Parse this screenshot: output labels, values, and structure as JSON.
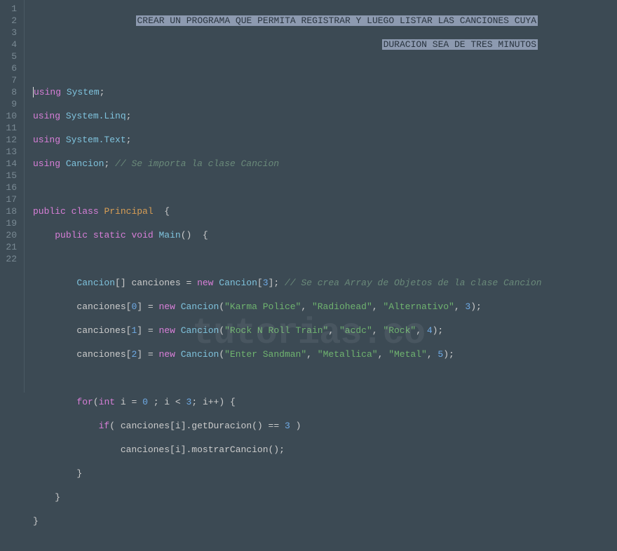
{
  "banner": {
    "line1": "CREAR UN PROGRAMA QUE PERMITA REGISTRAR Y LUEGO LISTAR LAS CANCIONES CUYA",
    "line2": "DURACION SEA DE TRES MINUTOS"
  },
  "code": {
    "kw_using": "using",
    "ns_system": "System",
    "ns_linq": "System.Linq",
    "ns_text": "System.Text",
    "ns_cancion": "Cancion",
    "com_import": "// Se importa la clase Cancion",
    "kw_public": "public",
    "kw_class": "class",
    "cls_principal": "Principal",
    "kw_static": "static",
    "kw_void": "void",
    "fn_main": "Main",
    "type_cancion": "Cancion",
    "var_canciones": "canciones",
    "kw_new": "new",
    "num_3": "3",
    "com_array": "// Se crea Array de Objetos de la clase Cancion",
    "idx_0": "0",
    "idx_1": "1",
    "idx_2": "2",
    "str_karma": "\"Karma Police\"",
    "str_radiohead": "\"Radiohead\"",
    "str_alternativo": "\"Alternativo\"",
    "str_rocknroll": "\"Rock N Roll Train\"",
    "str_acdc": "\"acdc\"",
    "str_rock": "\"Rock\"",
    "num_4": "4",
    "str_enter": "\"Enter Sandman\"",
    "str_metallica": "\"Metallica\"",
    "str_metal": "\"Metal\"",
    "num_5": "5",
    "kw_for": "for",
    "kw_int": "int",
    "var_i": "i",
    "num_0": "0",
    "kw_if": "if",
    "fn_getdur": ".getDuracion()",
    "fn_mostrar": ".mostrarCancion();",
    "op_eq": "=="
  },
  "line_numbers": [
    "1",
    "2",
    "3",
    "4",
    "5",
    "6",
    "7",
    "8",
    "9",
    "10",
    "11",
    "12",
    "13",
    "14",
    "15",
    "16",
    "17",
    "18",
    "19",
    "20",
    "21",
    "22"
  ],
  "watermark": "tutorias.co"
}
